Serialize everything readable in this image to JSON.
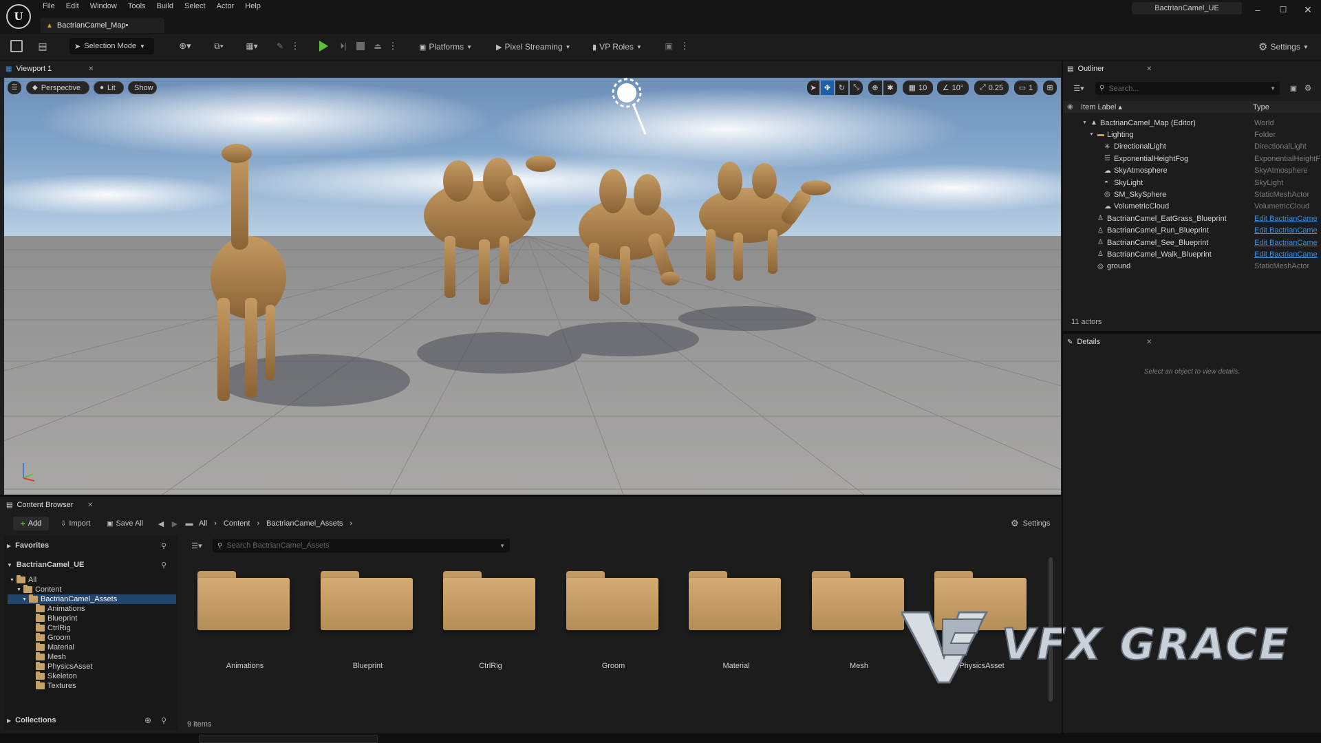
{
  "window": {
    "title": "BactrianCamel_UE",
    "map_tab": "BactrianCamel_Map•"
  },
  "menu": [
    "File",
    "Edit",
    "Window",
    "Tools",
    "Build",
    "Select",
    "Actor",
    "Help"
  ],
  "toolbar": {
    "selection_mode": "Selection Mode",
    "platforms": "Platforms",
    "pixel_streaming": "Pixel Streaming",
    "vp_roles": "VP Roles",
    "settings": "Settings"
  },
  "viewport": {
    "tab": "Viewport 1",
    "perspective": "Perspective",
    "lit": "Lit",
    "show": "Show",
    "grid_snap": "10",
    "rot_snap": "10°",
    "scale_snap": "0.25",
    "cam_speed": "1"
  },
  "outliner": {
    "tab": "Outliner",
    "search_placeholder": "Search...",
    "col_label": "Item Label ▴",
    "col_type": "Type",
    "rows": [
      {
        "label": "BactrianCamel_Map (Editor)",
        "type": "World",
        "link": false
      },
      {
        "label": "Lighting",
        "type": "Folder",
        "link": false
      },
      {
        "label": "DirectionalLight",
        "type": "DirectionalLight",
        "link": false
      },
      {
        "label": "ExponentialHeightFog",
        "type": "ExponentialHeightF",
        "link": false
      },
      {
        "label": "SkyAtmosphere",
        "type": "SkyAtmosphere",
        "link": false
      },
      {
        "label": "SkyLight",
        "type": "SkyLight",
        "link": false
      },
      {
        "label": "SM_SkySphere",
        "type": "StaticMeshActor",
        "link": false
      },
      {
        "label": "VolumetricCloud",
        "type": "VolumetricCloud",
        "link": false
      },
      {
        "label": "BactrianCamel_EatGrass_Blueprint",
        "type": "Edit BactrianCame",
        "link": true
      },
      {
        "label": "BactrianCamel_Run_Blueprint",
        "type": "Edit BactrianCame",
        "link": true
      },
      {
        "label": "BactrianCamel_See_Blueprint",
        "type": "Edit BactrianCame",
        "link": true
      },
      {
        "label": "BactrianCamel_Walk_Blueprint",
        "type": "Edit BactrianCame",
        "link": true
      },
      {
        "label": "ground",
        "type": "StaticMeshActor",
        "link": false
      }
    ],
    "actor_count": "11 actors"
  },
  "details": {
    "tab": "Details",
    "empty_text": "Select an object to view details."
  },
  "content_browser": {
    "tab": "Content Browser",
    "add": "Add",
    "import": "Import",
    "save_all": "Save All",
    "settings": "Settings",
    "path": [
      "All",
      "Content",
      "BactrianCamel_Assets"
    ],
    "favorites": "Favorites",
    "project": "BactrianCamel_UE",
    "tree_all": "All",
    "tree_content": "Content",
    "tree_assets": "BactrianCamel_Assets",
    "tree_children": [
      "Animations",
      "Blueprint",
      "CtrlRig",
      "Groom",
      "Material",
      "Mesh",
      "PhysicsAsset",
      "Skeleton",
      "Textures"
    ],
    "search_placeholder": "Search BactrianCamel_Assets",
    "folders": [
      "Animations",
      "Blueprint",
      "CtrlRig",
      "Groom",
      "Material",
      "Mesh",
      "PhysicsAsset"
    ],
    "collections": "Collections",
    "item_count": "9 items"
  },
  "watermark": {
    "text": "VFX GRACE"
  },
  "colors": {
    "accent_blue": "#1d5fa8",
    "play_green": "#5bbf3c",
    "folder": "#c8a26a",
    "link": "#3a8fe0",
    "selection": "#24466c"
  }
}
